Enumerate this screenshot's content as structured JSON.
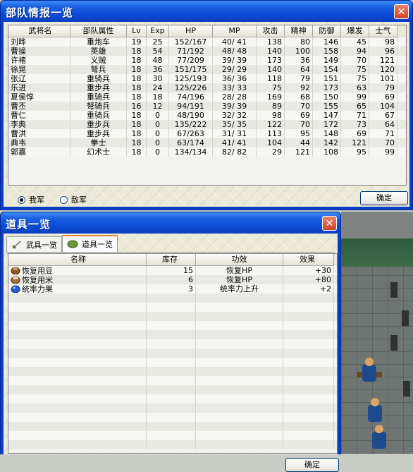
{
  "colors": {
    "title_bar": "#0b49d4",
    "close_button": "#c9452a",
    "active_tab_accent": "#e68b2c"
  },
  "unit_window": {
    "title": "部队情报一览",
    "close_icon": "close-icon",
    "columns": [
      "武将名",
      "部队属性",
      "Lv",
      "Exp",
      "HP",
      "MP",
      "攻击",
      "精神",
      "防御",
      "爆发",
      "士气"
    ],
    "rows": [
      [
        "刘晔",
        "重炮车",
        "19",
        "25",
        "152/167",
        "40/ 41",
        "138",
        "80",
        "146",
        "45",
        "98"
      ],
      [
        "曹操",
        "英雄",
        "18",
        "54",
        "71/192",
        "48/ 48",
        "140",
        "100",
        "158",
        "94",
        "96"
      ],
      [
        "许褚",
        "义贼",
        "18",
        "48",
        "77/209",
        "39/ 39",
        "173",
        "36",
        "149",
        "70",
        "121"
      ],
      [
        "徐晃",
        "弩兵",
        "18",
        "36",
        "151/175",
        "29/ 29",
        "140",
        "64",
        "154",
        "75",
        "120"
      ],
      [
        "张辽",
        "重骑兵",
        "18",
        "30",
        "125/193",
        "36/ 36",
        "118",
        "79",
        "151",
        "75",
        "101"
      ],
      [
        "乐进",
        "重步兵",
        "18",
        "24",
        "125/226",
        "33/ 33",
        "75",
        "92",
        "173",
        "63",
        "79"
      ],
      [
        "夏侯惇",
        "重骑兵",
        "18",
        "18",
        "74/196",
        "28/ 28",
        "169",
        "68",
        "150",
        "99",
        "69"
      ],
      [
        "曹丕",
        "弩骑兵",
        "16",
        "12",
        "94/191",
        "39/ 39",
        "89",
        "70",
        "155",
        "65",
        "104"
      ],
      [
        "曹仁",
        "重骑兵",
        "18",
        "0",
        "48/190",
        "32/ 32",
        "98",
        "69",
        "147",
        "71",
        "67"
      ],
      [
        "李典",
        "重步兵",
        "18",
        "0",
        "135/222",
        "35/ 35",
        "122",
        "70",
        "172",
        "73",
        "64"
      ],
      [
        "曹洪",
        "重步兵",
        "18",
        "0",
        "67/263",
        "31/ 31",
        "113",
        "95",
        "148",
        "69",
        "71"
      ],
      [
        "典韦",
        "拳士",
        "18",
        "0",
        "63/174",
        "41/ 41",
        "104",
        "44",
        "142",
        "121",
        "70"
      ],
      [
        "郭嘉",
        "幻术士",
        "18",
        "0",
        "134/134",
        "82/ 82",
        "29",
        "121",
        "108",
        "95",
        "99"
      ]
    ],
    "radio_own": "我军",
    "radio_enemy": "敌军",
    "selected_radio": "我军",
    "confirm_label": "确定"
  },
  "item_window": {
    "title": "道具一览",
    "close_icon": "close-icon",
    "tabs": [
      {
        "label": "武具一览",
        "icon": "sword-icon"
      },
      {
        "label": "道具一览",
        "icon": "bean-icon"
      }
    ],
    "active_tab": "道具一览",
    "columns": [
      "名称",
      "库存",
      "功效",
      "效果"
    ],
    "items": [
      {
        "icon": "bean-sack-icon",
        "name": "恢复用豆",
        "stock": "15",
        "effect": "恢复HP",
        "value": "+30"
      },
      {
        "icon": "rice-sack-icon",
        "name": "恢复用米",
        "stock": "6",
        "effect": "恢复HP",
        "value": "+80"
      },
      {
        "icon": "blue-fruit-icon",
        "name": "统率力果",
        "stock": "3",
        "effect": "统率力上升",
        "value": "+2"
      }
    ],
    "confirm_label": "确定"
  }
}
